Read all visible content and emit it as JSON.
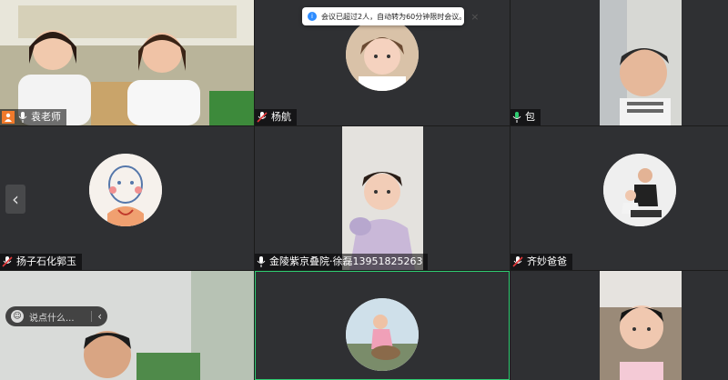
{
  "notification": {
    "icon": "info-icon",
    "text": "会议已超过2人，自动转为60分钟限时会议。",
    "close": "×"
  },
  "participants": [
    {
      "name": "袁老师",
      "host": true,
      "mic": "mic-on"
    },
    {
      "name": "杨航",
      "host": false,
      "mic": "mic-muted"
    },
    {
      "name": "包",
      "host": false,
      "mic": "mic-active"
    },
    {
      "name": "扬子石化郭玉",
      "host": false,
      "mic": "mic-muted"
    },
    {
      "name": "金陵紫京叠院·徐磊13951825263",
      "host": false,
      "mic": "mic-on"
    },
    {
      "name": "齐妙爸爸",
      "host": false,
      "mic": "mic-muted"
    }
  ],
  "navigation": {
    "prev_page": "‹"
  },
  "chat": {
    "placeholder": "说点什么...",
    "emoji_icon": "smile-icon",
    "collapse": "‹"
  },
  "colors": {
    "host_badge": "#f07a2b",
    "active_speaker_border": "#2ecc71",
    "tile_bg": "#2f3033"
  }
}
